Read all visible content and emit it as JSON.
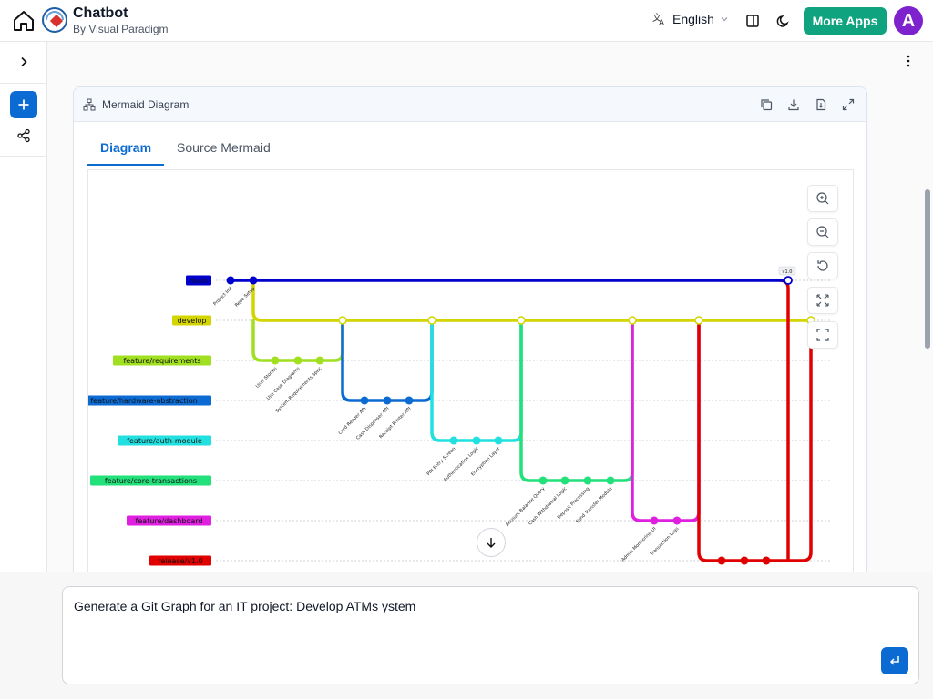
{
  "header": {
    "title": "Chatbot",
    "subtitle": "By Visual Paradigm",
    "language": "English",
    "more_apps_label": "More Apps",
    "avatar_initial": "A"
  },
  "card": {
    "title": "Mermaid Diagram",
    "tabs": [
      {
        "label": "Diagram",
        "active": true
      },
      {
        "label": "Source Mermaid",
        "active": false
      }
    ]
  },
  "graph": {
    "tag": "v1.0",
    "branches": [
      {
        "name": "main",
        "color": "#0000cc"
      },
      {
        "name": "develop",
        "color": "#d4d400"
      },
      {
        "name": "feature/requirements",
        "color": "#a0e020"
      },
      {
        "name": "feature/hardware-abstraction",
        "color": "#0b6bd3"
      },
      {
        "name": "feature/auth-module",
        "color": "#22e0e0"
      },
      {
        "name": "feature/core-transactions",
        "color": "#22e07a"
      },
      {
        "name": "feature/dashboard",
        "color": "#e020e0"
      },
      {
        "name": "release/v1.0",
        "color": "#e00000"
      }
    ],
    "commits": [
      {
        "label": "Project Init"
      },
      {
        "label": "Repo Setup"
      },
      {
        "label": "User Stories"
      },
      {
        "label": "Use Case Diagrams"
      },
      {
        "label": "System Requirements Spec"
      },
      {
        "label": "Card Reader API"
      },
      {
        "label": "Cash Dispenser API"
      },
      {
        "label": "Receipt Printer API"
      },
      {
        "label": "PIN Entry Screen"
      },
      {
        "label": "Authentication Logic"
      },
      {
        "label": "Encryption Layer"
      },
      {
        "label": "Account Balance Query"
      },
      {
        "label": "Cash Withdrawal Logic"
      },
      {
        "label": "Deposit Processing"
      },
      {
        "label": "Fund Transfer Module"
      },
      {
        "label": "Admin Monitoring UI"
      },
      {
        "label": "Transaction Logs"
      }
    ]
  },
  "prompt": {
    "text": "Generate a Git Graph for an IT project: Develop ATMs ystem"
  }
}
